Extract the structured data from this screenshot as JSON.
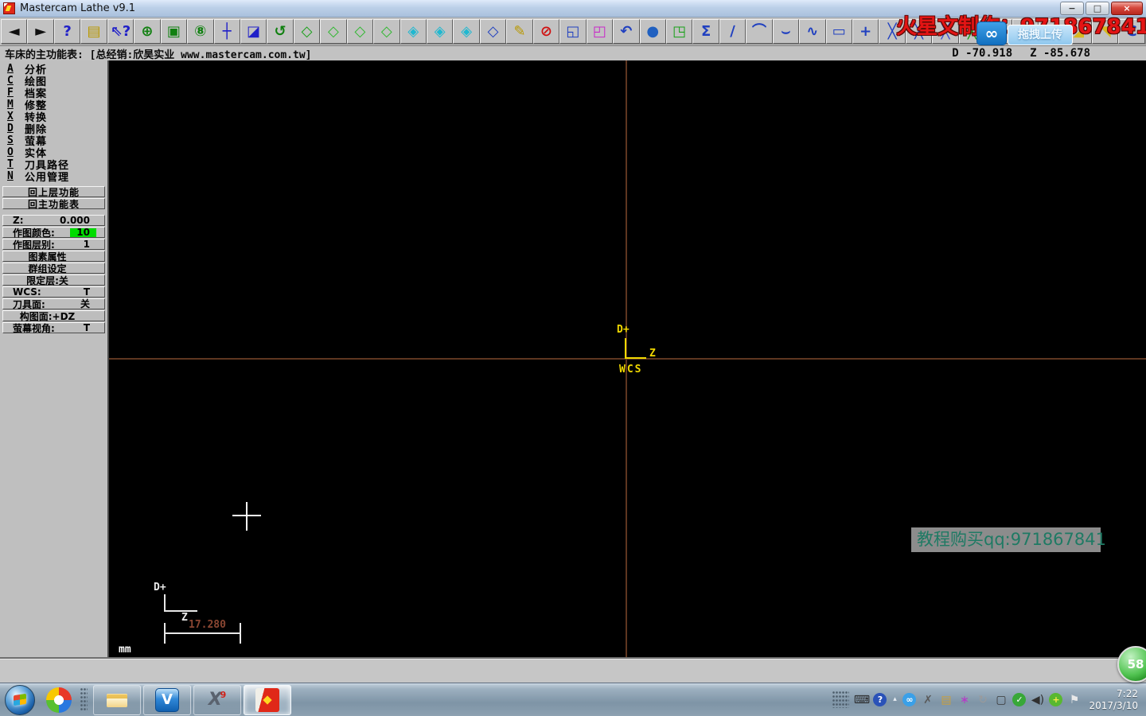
{
  "window": {
    "title": "Mastercam Lathe v9.1",
    "controls": [
      {
        "name": "minimize-button",
        "glyph": "−"
      },
      {
        "name": "restore-button",
        "glyph": "□"
      },
      {
        "name": "close-button",
        "glyph": "×",
        "cls": "close"
      }
    ]
  },
  "toolbar": {
    "buttons": [
      {
        "name": "back-menu-icon",
        "glyph": "◄",
        "color": "#101010"
      },
      {
        "name": "forward-menu-icon",
        "glyph": "►",
        "color": "#101010"
      },
      {
        "name": "help-icon",
        "glyph": "?",
        "color": "#2020c8"
      },
      {
        "name": "file-cabinet-icon",
        "glyph": "▤",
        "color": "#b89800"
      },
      {
        "name": "cursor-help-icon",
        "glyph": "⇖?",
        "color": "#2020c8"
      },
      {
        "name": "zoom-icon",
        "glyph": "⊕",
        "color": "#108010"
      },
      {
        "name": "zoom-window-icon",
        "glyph": "▣",
        "color": "#108010"
      },
      {
        "name": "zoom-back-icon",
        "glyph": "⑧",
        "color": "#108010"
      },
      {
        "name": "pan-icon",
        "glyph": "┼",
        "color": "#2020c8"
      },
      {
        "name": "repaint-icon",
        "glyph": "◪",
        "color": "#2020c8"
      },
      {
        "name": "rotate-view-icon",
        "glyph": "↺",
        "color": "#108010"
      },
      {
        "name": "gview-top-icon",
        "glyph": "◇",
        "color": "#18a018"
      },
      {
        "name": "gview-front-icon",
        "glyph": "◇",
        "color": "#30b830"
      },
      {
        "name": "gview-side-icon",
        "glyph": "◇",
        "color": "#30b830"
      },
      {
        "name": "gview-iso-icon",
        "glyph": "◇",
        "color": "#30b830"
      },
      {
        "name": "cplane-top-icon",
        "glyph": "◈",
        "color": "#20b8d0"
      },
      {
        "name": "cplane-front-icon",
        "glyph": "◈",
        "color": "#20b8d0"
      },
      {
        "name": "cplane-side-icon",
        "glyph": "◈",
        "color": "#20b8d0"
      },
      {
        "name": "cplane-3d-icon",
        "glyph": "◇",
        "color": "#2040c0"
      },
      {
        "name": "pencil-icon",
        "glyph": "✎",
        "color": "#b89800"
      },
      {
        "name": "pencil-off-icon",
        "glyph": "⊘",
        "color": "#d01010"
      },
      {
        "name": "copy-entities-icon",
        "glyph": "◱",
        "color": "#2040c0"
      },
      {
        "name": "copy-attributes-icon",
        "glyph": "◰",
        "color": "#c828c8"
      },
      {
        "name": "undo-icon",
        "glyph": "↶",
        "color": "#2040c0"
      },
      {
        "name": "shading-sphere-icon",
        "glyph": "●",
        "color": "#2060c0"
      },
      {
        "name": "scale-entities-icon",
        "glyph": "◳",
        "color": "#18a018"
      },
      {
        "name": "sigma-icon",
        "glyph": "Σ",
        "color": "#2040c0"
      },
      {
        "name": "line-icon",
        "glyph": "∕",
        "color": "#2040c0"
      },
      {
        "name": "arc-icon",
        "glyph": "⌒",
        "color": "#2040c0"
      },
      {
        "name": "curve-icon",
        "glyph": "⌣",
        "color": "#2040c0"
      },
      {
        "name": "spline-icon",
        "glyph": "∿",
        "color": "#2040c0"
      },
      {
        "name": "rectangle-icon",
        "glyph": "▭",
        "color": "#2040c0"
      },
      {
        "name": "point-icon",
        "glyph": "+",
        "color": "#2040c0"
      },
      {
        "name": "trim-1-icon",
        "glyph": "╳",
        "color": "#2040c0"
      },
      {
        "name": "trim-2-icon",
        "glyph": "╳",
        "color": "#2040c0"
      },
      {
        "name": "trim-3-icon",
        "glyph": "╳",
        "color": "#4050d0"
      },
      {
        "name": "trim-divide-icon",
        "glyph": "╳",
        "color": "#18a018"
      },
      {
        "name": "trim-extend-icon",
        "glyph": "╳",
        "color": "#18a018"
      },
      {
        "name": "break-icon",
        "glyph": "╳",
        "color": "#2040c0"
      },
      {
        "name": "surface-fillet-icon",
        "glyph": "◣",
        "color": "#d8b820"
      },
      {
        "name": "surface-trim-icon",
        "glyph": "◢",
        "color": "#d8b820"
      },
      {
        "name": "surface-extend-icon",
        "glyph": "◥",
        "color": "#d8b820"
      },
      {
        "name": "c-hook-icon",
        "glyph": "C",
        "color": "#2040c0"
      }
    ]
  },
  "prompt": {
    "menu_text": "车床的主功能表: [总经销:欣昊实业 www.mastercam.com.tw]",
    "coord_d": "D -70.918",
    "coord_z": "Z -85.678"
  },
  "sidebar": {
    "menu": [
      {
        "name": "menu-analyze",
        "key": "A",
        "label": "分析"
      },
      {
        "name": "menu-create",
        "key": "C",
        "label": "绘图"
      },
      {
        "name": "menu-file",
        "key": "F",
        "label": "档案"
      },
      {
        "name": "menu-modify",
        "key": "M",
        "label": "修整"
      },
      {
        "name": "menu-xform",
        "key": "X",
        "label": "转换"
      },
      {
        "name": "menu-delete",
        "key": "D",
        "label": "删除"
      },
      {
        "name": "menu-screen",
        "key": "S",
        "label": "萤幕"
      },
      {
        "name": "menu-solids",
        "key": "O",
        "label": "实体"
      },
      {
        "name": "menu-toolpaths",
        "key": "T",
        "label": "刀具路径"
      },
      {
        "name": "menu-nc-utils",
        "key": "N",
        "label": "公用管理"
      }
    ],
    "nav": [
      {
        "name": "backup-button",
        "label": "回上层功能"
      },
      {
        "name": "main-menu-button",
        "label": "回主功能表"
      }
    ],
    "status": [
      {
        "name": "status-z-depth",
        "label": "Z:",
        "value": "0.000"
      },
      {
        "name": "status-color",
        "label": "作图颜色:",
        "value": "10",
        "valueBg": "#00dc00"
      },
      {
        "name": "status-level",
        "label": "作图层别:",
        "value": "1"
      },
      {
        "name": "status-attributes",
        "label": "图素属性",
        "value": "",
        "center": true
      },
      {
        "name": "status-groups",
        "label": "群组设定",
        "value": "",
        "center": true
      },
      {
        "name": "status-mask",
        "label": "限定层:关",
        "value": "",
        "center": true
      },
      {
        "name": "status-wcs",
        "label": "WCS:",
        "value": "T"
      },
      {
        "name": "status-tplane",
        "label": "刀具面:",
        "value": "关"
      },
      {
        "name": "status-cplane",
        "label": "构图面:+DZ",
        "value": "",
        "center": true
      },
      {
        "name": "status-gview",
        "label": "萤幕视角:",
        "value": "T"
      }
    ]
  },
  "canvas": {
    "axis_center": {
      "d_label": "D+",
      "z_label": "Z",
      "wcs_label": "WCS"
    },
    "axis_corner": {
      "d_label": "D+",
      "z_label": "Z"
    },
    "scale_value": "17.280",
    "units": "mm",
    "colors": {
      "crosshair": "#5e3620",
      "gnomon": "#f0d800",
      "scale_text": "#8a4632"
    }
  },
  "overlay": {
    "red_watermark": "火星文制作：971867841",
    "upload_glyph": "∞",
    "upload_tooltip": "拖拽上传",
    "canvas_watermark": "教程购买qq:971867841",
    "ball_text": "58"
  },
  "taskbar": {
    "apps": [
      {
        "name": "taskbar-explorer",
        "cls": "app-explorer",
        "glyph": "",
        "sup": ""
      },
      {
        "name": "taskbar-v-app",
        "cls": "app-v",
        "glyph": "V",
        "sup": ""
      },
      {
        "name": "taskbar-mastercam-x9",
        "cls": "app-x9",
        "glyph": "X",
        "sup": "9"
      },
      {
        "name": "taskbar-mastercam-lathe9",
        "cls": "app-mcam9",
        "glyph": "",
        "sup": "",
        "active": true
      }
    ],
    "tray": [
      {
        "name": "tray-grip",
        "cls": "grip",
        "glyph": ""
      },
      {
        "name": "keyboard-icon",
        "glyph": "⌨",
        "color": "#2a2a2a"
      },
      {
        "name": "help-badge-icon",
        "glyph": "?",
        "color": "#ffffff",
        "bg": "#2a52b8",
        "cls": "round"
      },
      {
        "name": "show-hidden-icons",
        "glyph": "▴",
        "color": "#e8eef4",
        "cls": "small"
      },
      {
        "name": "cloud-app-icon",
        "glyph": "∞",
        "color": "#ffffff",
        "bg": "#3aa0e8",
        "cls": "round"
      },
      {
        "name": "snip-tool-icon",
        "glyph": "✗",
        "color": "#5a5a5a"
      },
      {
        "name": "document-info-icon",
        "glyph": "▤",
        "color": "#c8a040"
      },
      {
        "name": "colorful-app-icon",
        "glyph": "∗",
        "color": "#b838c8"
      },
      {
        "name": "sync-icon",
        "glyph": "↻",
        "color": "#9a9a9a"
      },
      {
        "name": "network-icon",
        "glyph": "▢",
        "color": "#383838"
      },
      {
        "name": "shield-icon",
        "glyph": "✓",
        "color": "#ffffff",
        "bg": "#38a838",
        "cls": "round"
      },
      {
        "name": "volume-icon",
        "glyph": "◀)",
        "color": "#303030"
      },
      {
        "name": "safe-360-icon",
        "glyph": "+",
        "color": "#ffe84a",
        "bg": "#58b830",
        "cls": "round"
      },
      {
        "name": "action-center-flag-icon",
        "glyph": "⚑",
        "color": "#e8e8e8"
      }
    ],
    "clock": {
      "time": "7:22",
      "date": "2017/3/10"
    }
  }
}
